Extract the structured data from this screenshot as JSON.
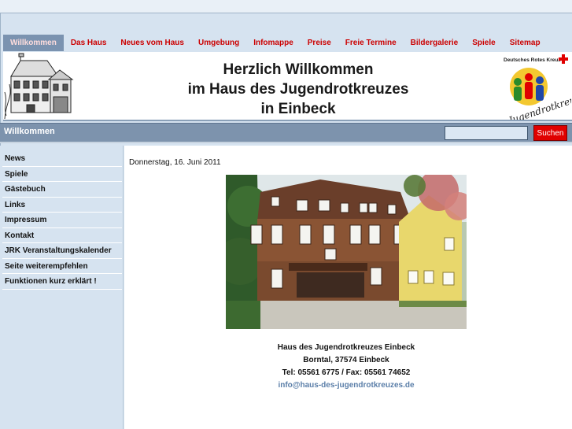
{
  "nav": {
    "items": [
      {
        "label": "Willkommen",
        "active": true
      },
      {
        "label": "Das Haus"
      },
      {
        "label": "Neues vom Haus"
      },
      {
        "label": "Umgebung"
      },
      {
        "label": "Infomappe"
      },
      {
        "label": "Preise"
      },
      {
        "label": "Freie Termine"
      },
      {
        "label": "Bildergalerie"
      },
      {
        "label": "Spiele"
      },
      {
        "label": "Sitemap"
      }
    ]
  },
  "header": {
    "title_line1": "Herzlich Willkommen",
    "title_line2": "im Haus des Jugendrotkreuzes",
    "title_line3": "in Einbeck",
    "logo_top_text": "Deutsches Rotes Kreuz",
    "logo_bottom_text": "Jugendrotkreuz"
  },
  "titlebar": {
    "page_title": "Willkommen",
    "search_placeholder": "",
    "search_button": "Suchen"
  },
  "sidebar": {
    "items": [
      {
        "label": "News"
      },
      {
        "label": "Spiele"
      },
      {
        "label": "Gästebuch"
      },
      {
        "label": "Links"
      },
      {
        "label": "Impressum"
      },
      {
        "label": "Kontakt"
      },
      {
        "label": "JRK Veranstaltungskalender"
      },
      {
        "label": "Seite weiterempfehlen"
      },
      {
        "label": "Funktionen kurz erklärt !"
      }
    ]
  },
  "content": {
    "date": "Donnerstag, 16. Juni 2011",
    "address_name": "Haus des Jugendrotkreuzes Einbeck",
    "address_street": "Borntal, 37574 Einbeck",
    "address_phone": "Tel: 05561 6775 / Fax: 05561 74652",
    "address_email": "info@haus-des-jugendrotkreuzes.de"
  },
  "colors": {
    "nav_text": "#cc0000",
    "nav_active_bg": "#7b93b0",
    "titlebar_bg": "#7d93ad",
    "sidebar_bg": "#d6e3f0",
    "search_button_bg": "#e00000",
    "link_color": "#5a7ea8"
  }
}
